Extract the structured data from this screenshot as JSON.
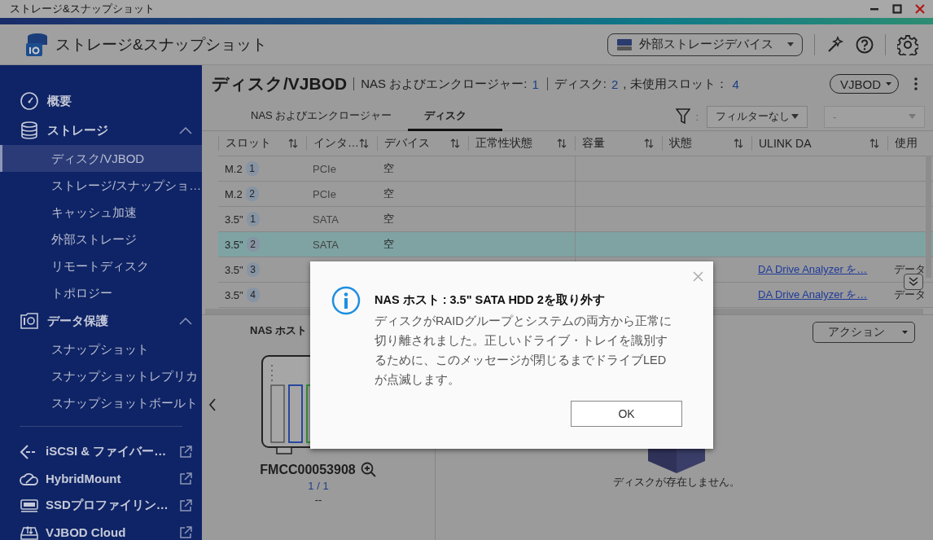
{
  "window": {
    "title": "ストレージ&スナップショット"
  },
  "header": {
    "app_title": "ストレージ&スナップショット",
    "device_selector": "外部ストレージデバイス"
  },
  "sidebar": {
    "nav": [
      {
        "kind": "page",
        "label": "概要"
      },
      {
        "kind": "section",
        "label": "ストレージ",
        "expanded": true,
        "children": [
          {
            "label": "ディスク/VJBOD",
            "selected": true
          },
          {
            "label": "ストレージ/スナップショ…",
            "selected": false
          },
          {
            "label": "キャッシュ加速",
            "selected": false
          },
          {
            "label": "外部ストレージ",
            "selected": false
          },
          {
            "label": "リモートディスク",
            "selected": false
          },
          {
            "label": "トポロジー",
            "selected": false
          }
        ]
      },
      {
        "kind": "section",
        "label": "データ保護",
        "expanded": true,
        "children": [
          {
            "label": "スナップショット",
            "selected": false
          },
          {
            "label": "スナップショットレプリカ",
            "selected": false
          },
          {
            "label": "スナップショットボールト",
            "selected": false
          }
        ]
      }
    ],
    "apps": [
      {
        "label": "iSCSI & ファイバー…"
      },
      {
        "label": "HybridMount"
      },
      {
        "label": "SSDプロファイリン…"
      },
      {
        "label": "VJBOD Cloud"
      }
    ]
  },
  "main": {
    "title": "ディスク/VJBOD",
    "summary": [
      {
        "label": "NAS およびエンクロージャー:",
        "value": "1"
      },
      {
        "label": "ディスク:",
        "value": "2"
      },
      {
        "label": ", 未使用スロット：",
        "value": "4"
      }
    ],
    "view_selector": "VJBOD",
    "tabs": [
      {
        "label": "NAS およびエンクロージャー",
        "selected": false
      },
      {
        "label": "ディスク",
        "selected": true
      }
    ],
    "filter": {
      "separator": ":",
      "value": "フィルターなし"
    },
    "filter_2": {
      "value": "-",
      "disabled": true
    }
  },
  "table": {
    "columns": [
      "スロット",
      "インタ…",
      "デバイス",
      "正常性状態",
      "容量",
      "状態",
      "ULINK DA",
      "使用"
    ],
    "rows": [
      {
        "slot_type": "M.2",
        "slot_number": "1",
        "interface": "PCIe",
        "device": "空",
        "selected": false
      },
      {
        "slot_type": "M.2",
        "slot_number": "2",
        "interface": "PCIe",
        "device": "空",
        "selected": false
      },
      {
        "slot_type": "3.5\"",
        "slot_number": "1",
        "interface": "SATA",
        "device": "空",
        "selected": false
      },
      {
        "slot_type": "3.5\"",
        "slot_number": "2",
        "interface": "SATA",
        "device": "空",
        "selected": true
      },
      {
        "slot_type": "3.5\"",
        "slot_number": "3",
        "ulink": "DA Drive Analyzer を…",
        "usage": "データ",
        "selected": false
      },
      {
        "slot_type": "3.5\"",
        "slot_number": "4",
        "ulink": "DA Drive Analyzer を…",
        "usage": "データ",
        "selected": false
      }
    ]
  },
  "enclosure_panel": {
    "title": "NAS ホスト",
    "device_name": "FMCC00053908",
    "page": "1 / 1",
    "status": "--"
  },
  "disk_panel": {
    "action_button": "アクション",
    "empty_message": "ディスクが存在しません。"
  },
  "dialog": {
    "title": "NAS ホスト : 3.5\" SATA HDD 2を取り外す",
    "message": "ディスクがRAIDグループとシステムの両方から正常に切り離されました。正しいドライブ・トレイを識別するために、このメッセージが閉じるまでドライブLEDが点滅します。",
    "ok_button": "OK"
  }
}
